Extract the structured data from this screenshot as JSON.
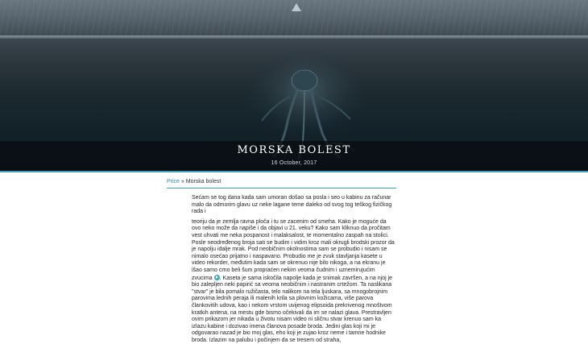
{
  "post": {
    "title": "Morska bolest",
    "date": "16 October, 2017"
  },
  "breadcrumb": {
    "parent": "Price",
    "separator": " » ",
    "current": "Morska bolest"
  },
  "article": {
    "intro": "Sećam se tog dana kada sam umoran došao sa posla i seo u kabinu za računar malo da odmorim glavu uz neke lagane teme daleko od svog tog teškog fizičkog rada i",
    "body_part1": "teoriju da je zemlja ravna ploča i tu se zacenim od smeha. Kako je moguće da ovo neko može da napiše i da objavi u 21. veku? Kako sam kliknuo da pročitam vest uhvati me neka pospanost i malaksalost, te momentalno zaspah na stolici. Posle neodređenog broja sati se budim i vidim kroz mali okrugli brodski prozor da je napolju idalje mrak. Pod neobičnim okolnostima sam se probudio i nisam se nimalo osećao prijatno i naspavano. Probudio me je zvuk stavljanja kasete u video rekorder, međutim kada sam se okrenuo nije bilo nikoga, a na ekranu je išao samo crno beli šum propraćen nekim veoma čudnim i uznemirujućim zvucima",
    "body_part2": ". Kaseta je sama iskočila napolje kada je snimak završen, a na njoj je bio zalepljen neki papirić sa veoma neobičnim i nastranim crtežom. Ta naslikana \"stvar\" je bila pomalo ružičasta, telo nalikom na tela ljuskara, sa mnogobrojnim parovima lednih peraja ili malenih krila sa plovnim kožicama, više parova člankovitih udova, kao i nekom vrstom uvijenog elipsoida prekrivenog mnoštvom kratkih antena, na mestu gde bismo očekivali da im se nalazi glava. Prestravljen ovim prikazom jer nikada u životu nisam video ni sličnu stvar krenuo sam ka izlazu kabine i dozivao imena članova posade broda. Jedini glas koji mi je odgovarao nazad je bio moj glas, eho koji je zujao kroz neme i tamne hodnike broda. Izlazim na palubu i počinjem da se tresem od straha,"
  },
  "colors": {
    "accent": "#3aa6b9",
    "link": "#2a8fb0"
  }
}
